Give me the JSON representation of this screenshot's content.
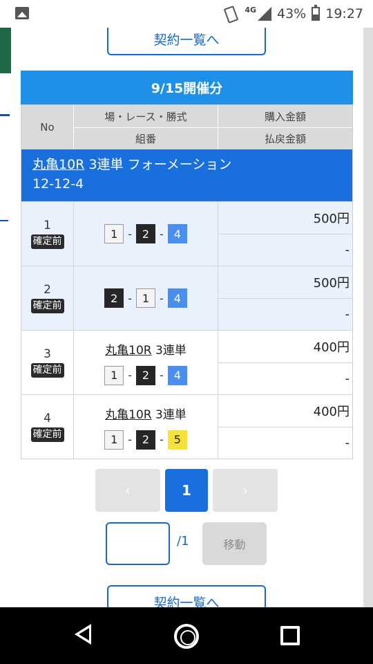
{
  "status_bar": {
    "network": "4G",
    "battery": "43%",
    "time": "19:27"
  },
  "modal": {
    "list_button_label": "契約一覧へ",
    "date_header": "9/15開催分",
    "table_header": {
      "no": "No",
      "race_type": "場・レース・勝式",
      "combination": "組番",
      "purchase_amount": "購入金額",
      "payout_amount": "払戻金額"
    },
    "bet_bar": {
      "race": "丸亀10R",
      "type": "3連単 フォーメーション",
      "combination": "12-12-4"
    },
    "rows": [
      {
        "no": "1",
        "status": "確定前",
        "race": "",
        "race_type": "",
        "boats": [
          "1",
          "2",
          "4"
        ],
        "purchase": "500円",
        "payout": "-"
      },
      {
        "no": "2",
        "status": "確定前",
        "race": "",
        "race_type": "",
        "boats": [
          "2",
          "1",
          "4"
        ],
        "purchase": "500円",
        "payout": "-"
      },
      {
        "no": "3",
        "status": "確定前",
        "race": "丸亀10R",
        "race_type": "3連単",
        "boats": [
          "1",
          "2",
          "4"
        ],
        "purchase": "400円",
        "payout": "-"
      },
      {
        "no": "4",
        "status": "確定前",
        "race": "丸亀10R",
        "race_type": "3連単",
        "boats": [
          "1",
          "2",
          "5"
        ],
        "purchase": "400円",
        "payout": "-"
      }
    ],
    "combo_separator": "-",
    "pagination": {
      "prev": "‹",
      "current": "1",
      "next": "›",
      "total": "/1",
      "move_button": "移動",
      "page_input_value": ""
    }
  },
  "colors": {
    "accent_blue": "#1a6fde",
    "header_blue": "#1e90e8",
    "boat_1": "#f3f3f3",
    "boat_2": "#262626",
    "boat_4": "#4a8ef0",
    "boat_5": "#f7e03a"
  }
}
